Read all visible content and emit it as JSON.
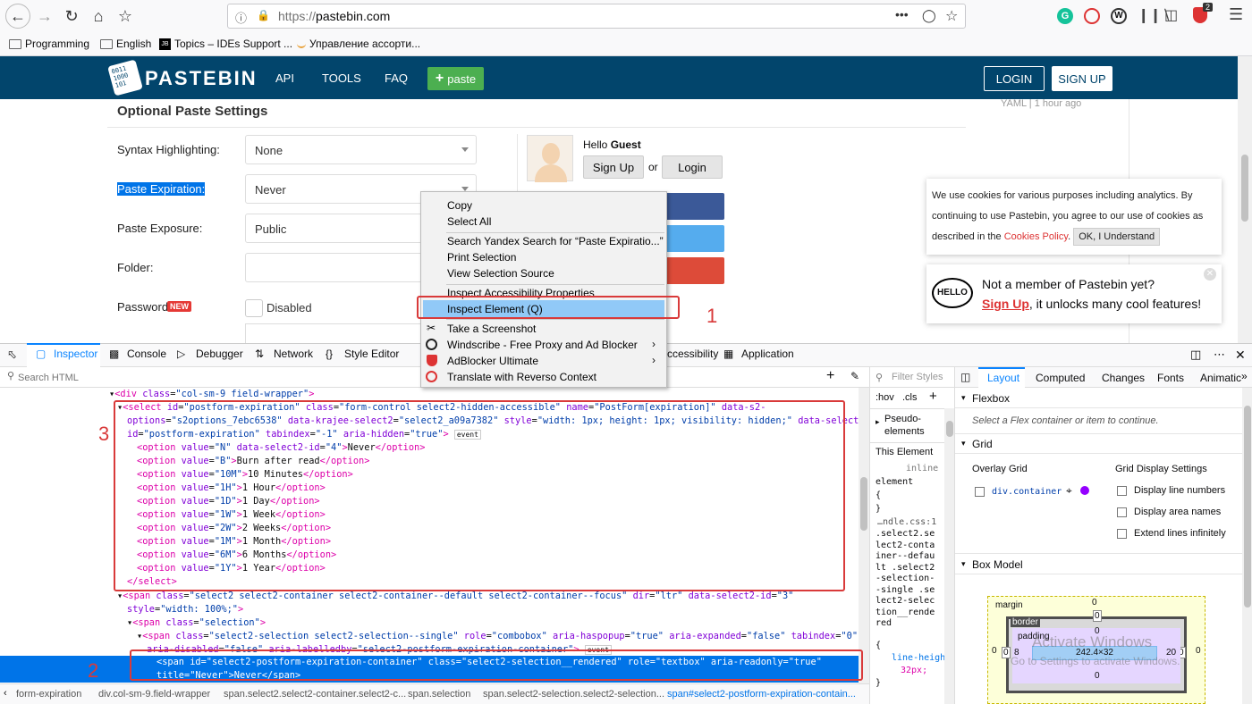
{
  "browser": {
    "url_scheme": "https://",
    "url_host": "pastebin.com",
    "dots": "•••",
    "bookmarks": [
      "Programming",
      "English",
      "Topics – IDEs Support ...",
      "Управление ассорти..."
    ],
    "badge": "2"
  },
  "pastebin": {
    "logo": "PASTEBIN",
    "nav": [
      "API",
      "TOOLS",
      "FAQ"
    ],
    "paste_button": "paste",
    "login": "LOGIN",
    "signup": "SIGN UP",
    "section_title": "Optional Paste Settings",
    "recent_meta": "YAML | 1 hour ago",
    "labels": {
      "syntax": "Syntax Highlighting:",
      "expiration": "Paste Expiration:",
      "exposure": "Paste Exposure:",
      "folder": "Folder:",
      "password": "Password",
      "new_badge": "NEW"
    },
    "values": {
      "syntax": "None",
      "expiration": "Never",
      "exposure": "Public",
      "folder": "",
      "password": "Disabled"
    },
    "guest": {
      "hello": "Hello",
      "name": "Guest",
      "signup": "Sign Up",
      "or": "or",
      "login": "Login"
    },
    "cookie": {
      "text1": "We use cookies for various purposes including analytics. By continuing to use Pastebin, you agree to our use of cookies as described in the",
      "link": "Cookies Policy",
      "text2": ".",
      "button": "OK, I Understand"
    },
    "member": {
      "hello_logo": "HELLO",
      "line1": "Not a member of Pastebin yet?",
      "link": "Sign Up",
      "line2": ", it unlocks many cool features!"
    }
  },
  "context_menu": {
    "items": [
      "Copy",
      "Select All",
      "Search Yandex Search for “Paste Expiratio...”",
      "Print Selection",
      "View Selection Source",
      "Inspect Accessibility Properties",
      "Inspect Element (Q)",
      "Take a Screenshot",
      "Windscribe - Free Proxy and Ad Blocker",
      "AdBlocker Ultimate",
      "Translate with Reverso Context"
    ]
  },
  "annotations": {
    "n1": "1",
    "n2": "2",
    "n3": "3"
  },
  "devtools": {
    "tabs": [
      "Inspector",
      "Console",
      "Debugger",
      "Network",
      "Style Editor",
      "ccessibility",
      "Application"
    ],
    "search_placeholder": "Search HTML",
    "filter_styles": "Filter Styles",
    "hov": ":hov",
    "cls": ".cls",
    "pseudo": "Pseudo-elements",
    "this_element": "This Element",
    "inline": "inline",
    "element_rule": "element",
    "brace_open": "{",
    "brace_close": "}",
    "css_file": "…ndle.css:1",
    "css_selector": ".select2.select2-container--default .select2-selection--single .select2-selection__rendered",
    "css_prop": "line-height:",
    "css_val": "32px;",
    "right_tabs": [
      "Layout",
      "Computed",
      "Changes",
      "Fonts",
      "Animatic"
    ],
    "flexbox": "Flexbox",
    "flexbox_hint": "Select a Flex container or item to continue.",
    "grid": "Grid",
    "overlay_grid": "Overlay Grid",
    "grid_item": "div.container",
    "grid_settings": "Grid Display Settings",
    "grid_options": [
      "Display line numbers",
      "Display area names",
      "Extend lines infinitely"
    ],
    "box_model": "Box Model",
    "bm": {
      "margin": "margin",
      "border": "border",
      "padding": "padding",
      "size": "242.4×32",
      "zero": "0",
      "pad_left": "8",
      "pad_right": "20"
    },
    "watermark1": "Activate Windows",
    "watermark2": "Go to Settings to activate Windows.",
    "breadcrumbs": [
      "form-expiration",
      "div.col-sm-9.field-wrapper",
      "span.select2.select2-container.select2-c...",
      "span.selection",
      "span.select2-selection.select2-selection...",
      "span#select2-postform-expiration-contain..."
    ],
    "event": "event"
  }
}
